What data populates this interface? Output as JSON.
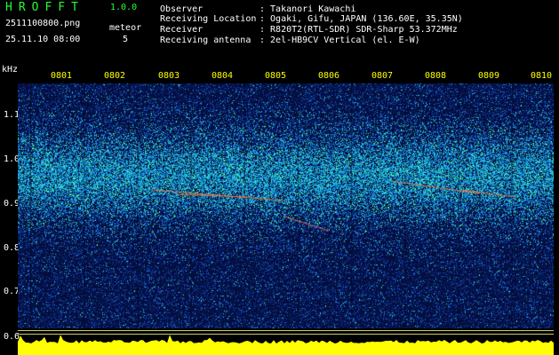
{
  "app": {
    "logo": "HROFFT",
    "version": "1.0.0",
    "filename": "2511100800.png",
    "datetime": "25.11.10 08:00",
    "meteor_label": "meteor",
    "meteor_count": "5"
  },
  "info": [
    {
      "label": "Observer",
      "value": ": Takanori Kawachi"
    },
    {
      "label": "Receiving Location",
      "value": ": Ogaki, Gifu, JAPAN (136.60E, 35.35N)"
    },
    {
      "label": "Receiver",
      "value": ": R820T2(RTL-SDR) SDR-Sharp 53.372MHz"
    },
    {
      "label": "Receiving antenna",
      "value": ": 2el-HB9CV Vertical (el. E-W)"
    }
  ],
  "axes": {
    "y_unit": "kHz",
    "y_ticks": [
      "1.1",
      "1.0",
      "0.9",
      "0.8",
      "0.7",
      "0.6"
    ],
    "x_ticks": [
      "0801",
      "0802",
      "0803",
      "0804",
      "0805",
      "0806",
      "0807",
      "0808",
      "0809",
      "0810"
    ]
  },
  "colors": {
    "background": "#000000",
    "text_green": "#22ff33",
    "text_yellow": "#ffff00",
    "spectrogram_low": "#0a1a5a",
    "spectrogram_mid": "#1a6ad8",
    "spectrogram_high": "#30ffb0",
    "level_bar": "#ffff00",
    "marker_line": "#cccc66"
  }
}
